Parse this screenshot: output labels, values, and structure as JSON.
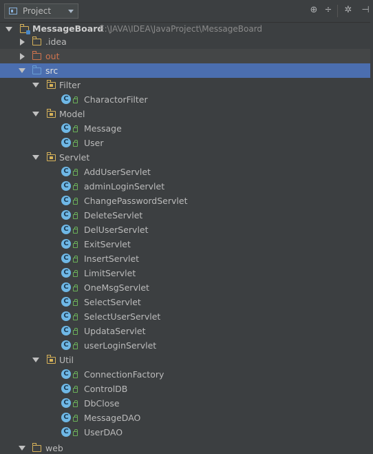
{
  "toolbar": {
    "view_label": "Project",
    "icons": [
      "locate-icon",
      "collapse-all-icon",
      "settings-icon",
      "hide-icon"
    ]
  },
  "tree": {
    "root": {
      "label": "MessageBoard",
      "path": "E:\\JAVA\\IDEA\\JavaProject\\MessageBoard"
    },
    "folders": {
      "idea": ".idea",
      "out": "out",
      "src": "src",
      "web": "web"
    },
    "packages": {
      "filter": {
        "label": "Filter",
        "classes": [
          "CharactorFilter"
        ]
      },
      "model": {
        "label": "Model",
        "classes": [
          "Message",
          "User"
        ]
      },
      "servlet": {
        "label": "Servlet",
        "classes": [
          "AddUserServlet",
          "adminLoginServlet",
          "ChangePasswordServlet",
          "DeleteServlet",
          "DelUserServlet",
          "ExitServlet",
          "InsertServlet",
          "LimitServlet",
          "OneMsgServlet",
          "SelectServlet",
          "SelectUserServlet",
          "UpdataServlet",
          "userLoginServlet"
        ]
      },
      "util": {
        "label": "Util",
        "classes": [
          "ConnectionFactory",
          "ControlDB",
          "DbClose",
          "MessageDAO",
          "UserDAO"
        ]
      }
    }
  },
  "colors": {
    "background": "#3c3f41",
    "selection": "#4b6eaf",
    "folder": "#d8b35a",
    "source_folder": "#6a9fd4",
    "excluded_folder": "#d0744f",
    "class_icon": "#6fb8e6"
  }
}
